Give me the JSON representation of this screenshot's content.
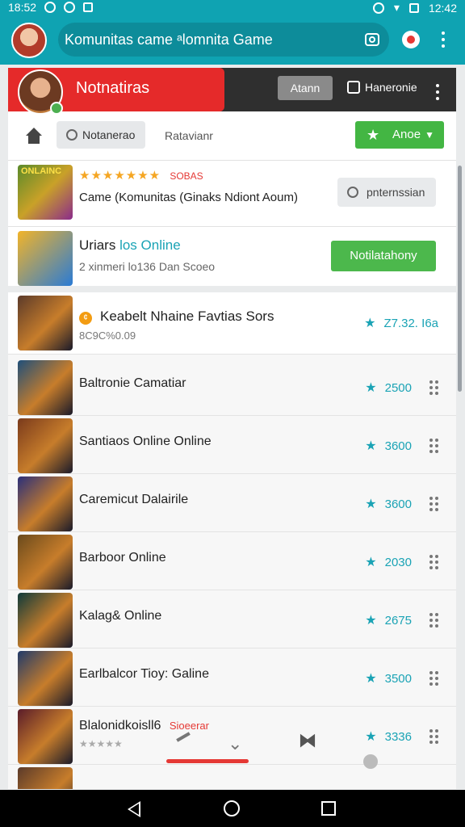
{
  "status_bar": {
    "time_left": "18:52",
    "time_right": "12:42"
  },
  "app_bar": {
    "search_text": "Komunitas came ᵃlomnita Game"
  },
  "panel": {
    "header_title": "Notnatiras",
    "grey_button": "Atann",
    "right_label": "Haneronie",
    "tabs": [
      "Notanerao",
      "Ratavianr"
    ],
    "green_dropdown": "Anoe",
    "featured": {
      "thumb_text": "ONLAINC",
      "stars": "★★★★★★★",
      "extra": "SOBAS",
      "title": "Came (Komunitas (Ginaks Ndiont Aoum)",
      "button": "pnternssian"
    },
    "online": {
      "title_a": "Uriars",
      "title_b": "los Online",
      "subtitle": "2 xinmeri lo136  Dan Scoeo",
      "button": "Notilatahony"
    }
  },
  "list": {
    "first": {
      "title": "Keabelt Nhaine Favtias Sors",
      "sub": "8C9C%0.09",
      "rating": "Z7.32. I6a"
    },
    "rows": [
      {
        "title": "Baltronie Camatiar",
        "rating": "2500"
      },
      {
        "title": "Santiaos Online Online",
        "rating": "3600"
      },
      {
        "title": "Caremicut Dalairile",
        "rating": "3600"
      },
      {
        "title": "Barboor Online",
        "rating": "2030"
      },
      {
        "title": "Kalag& Online",
        "rating": "2675"
      },
      {
        "title": "Earlbalcor Tioy: Galine",
        "rating": "3500"
      },
      {
        "title": "Blalonidkoisll6",
        "rating": "3336",
        "extra": "Sioeerar",
        "sub_stars": "★★★★★"
      }
    ],
    "thumb_colors": [
      "#5b3a2a",
      "#1f4f7a",
      "#7a3a1c",
      "#2a2f7a",
      "#6a4a1c",
      "#0f3a3a",
      "#203a6a",
      "#5a1c2a"
    ]
  },
  "colors": {
    "teal": "#0fa3b2",
    "red": "#e52a2a",
    "green": "#43b643",
    "rating": "#1aa3b5"
  },
  "icons": [
    "avatar",
    "camera-icon",
    "google-icon",
    "more-icon",
    "home-icon",
    "clock-icon",
    "star-icon",
    "chevron-down-icon",
    "drag-handle-icon",
    "back-icon",
    "home-nav-icon",
    "recent-icon"
  ]
}
